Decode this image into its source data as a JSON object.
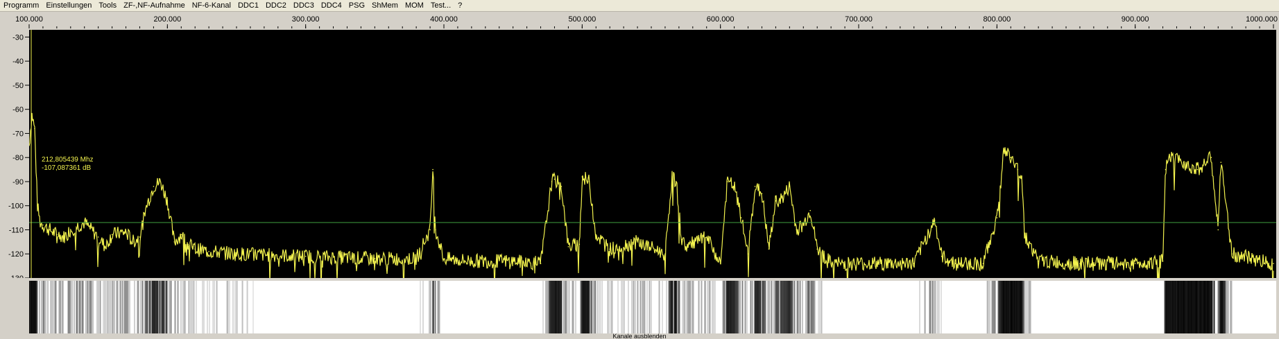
{
  "menu": [
    "Programm",
    "Einstellungen",
    "Tools",
    "ZF-,NF-Aufnahme",
    "NF-6-Kanal",
    "DDC1",
    "DDC2",
    "DDC3",
    "DDC4",
    "PSG",
    "ShMem",
    "MOM",
    "Test...",
    "?"
  ],
  "freq_axis": {
    "ticks": [
      "100.000",
      "200.000",
      "300.000",
      "400.000",
      "500.000",
      "600.000",
      "700.000",
      "800.000",
      "900.000",
      "1000.000"
    ]
  },
  "level_axis": {
    "ticks": [
      "-30",
      "-40",
      "-50",
      "-60",
      "-70",
      "-80",
      "-90",
      "-100",
      "-110",
      "-120",
      "-130"
    ]
  },
  "cursor": {
    "freq": "212,805439 Mhz",
    "level": "-107,087361 dB"
  },
  "status": "Kanale ausblenden",
  "colors": {
    "trace": "#f2f24e",
    "threshold": "#3fa03f",
    "background": "#000000"
  },
  "chart_data": {
    "type": "line",
    "xlabel": "",
    "ylabel": "",
    "xlim": [
      100,
      1000
    ],
    "ylim": [
      -130,
      -27
    ],
    "threshold_db": -107,
    "x": [
      100,
      102,
      104,
      106,
      108,
      110,
      115,
      120,
      125,
      130,
      140,
      150,
      155,
      160,
      170,
      175,
      180,
      185,
      190,
      195,
      200,
      205,
      210,
      215,
      218,
      220,
      230,
      250,
      300,
      350,
      380,
      390,
      392,
      394,
      400,
      420,
      450,
      470,
      478,
      480,
      485,
      490,
      498,
      500,
      505,
      510,
      520,
      540,
      560,
      565,
      568,
      572,
      575,
      590,
      600,
      605,
      610,
      615,
      620,
      625,
      630,
      635,
      640,
      645,
      650,
      655,
      660,
      665,
      670,
      680,
      700,
      720,
      740,
      755,
      760,
      770,
      790,
      800,
      805,
      810,
      815,
      818,
      820,
      830,
      860,
      900,
      920,
      922,
      925,
      935,
      945,
      955,
      960,
      962,
      970,
      1000
    ],
    "values": [
      -75,
      -62,
      -68,
      -100,
      -107,
      -108,
      -110,
      -112,
      -113,
      -110,
      -107,
      -113,
      -117,
      -112,
      -111,
      -115,
      -113,
      -100,
      -92,
      -90,
      -98,
      -115,
      -112,
      -116,
      -117,
      -118,
      -119,
      -120,
      -121,
      -122,
      -122,
      -110,
      -85,
      -110,
      -122,
      -123,
      -123,
      -124,
      -90,
      -89,
      -92,
      -117,
      -116,
      -88,
      -90,
      -112,
      -118,
      -115,
      -120,
      -88,
      -90,
      -114,
      -117,
      -113,
      -124,
      -90,
      -92,
      -105,
      -120,
      -92,
      -95,
      -118,
      -98,
      -97,
      -92,
      -110,
      -108,
      -102,
      -118,
      -124,
      -124,
      -124,
      -124,
      -106,
      -121,
      -124,
      -124,
      -105,
      -77,
      -80,
      -85,
      -88,
      -112,
      -123,
      -124,
      -124,
      -123,
      -85,
      -80,
      -82,
      -85,
      -80,
      -110,
      -82,
      -120,
      -124
    ]
  }
}
